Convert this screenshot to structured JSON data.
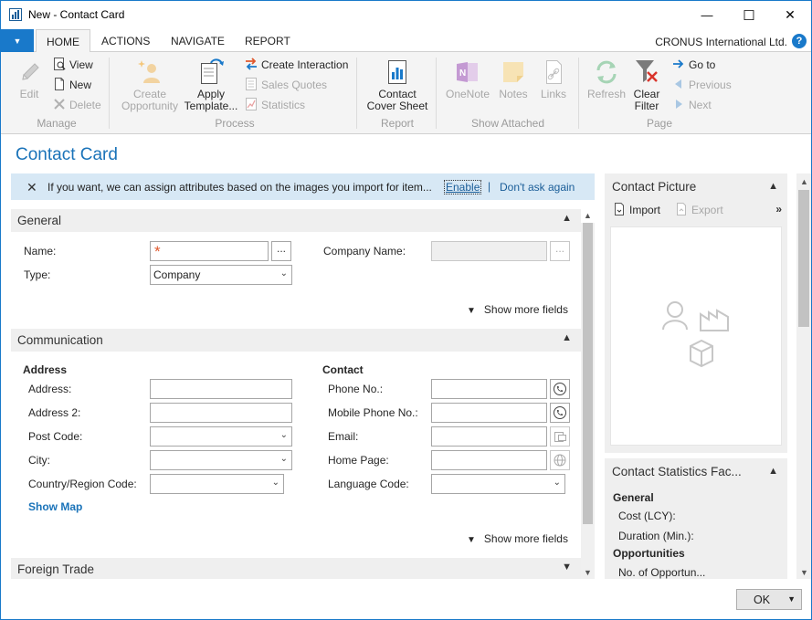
{
  "window": {
    "title": "New - Contact Card",
    "minimize_glyph": "—",
    "maximize_glyph": "☐",
    "close_glyph": "✕"
  },
  "ribbon_tabs": {
    "items": [
      {
        "label": "HOME",
        "active": true
      },
      {
        "label": "ACTIONS",
        "active": false
      },
      {
        "label": "NAVIGATE",
        "active": false
      },
      {
        "label": "REPORT",
        "active": false
      }
    ],
    "company": "CRONUS International Ltd.",
    "help_glyph": "?"
  },
  "ribbon": {
    "manage": {
      "label": "Manage",
      "edit": "Edit",
      "view": "View",
      "new": "New",
      "delete": "Delete"
    },
    "process": {
      "label": "Process",
      "create_opportunity": "Create Opportunity",
      "apply_template": "Apply Template...",
      "create_interaction": "Create Interaction",
      "sales_quotes": "Sales Quotes",
      "statistics": "Statistics"
    },
    "report": {
      "label": "Report",
      "contact_cover_sheet": "Contact Cover Sheet"
    },
    "show_attached": {
      "label": "Show Attached",
      "onenote": "OneNote",
      "notes": "Notes",
      "links": "Links"
    },
    "page": {
      "label": "Page",
      "refresh": "Refresh",
      "clear_filter": "Clear Filter",
      "go_to": "Go to",
      "previous": "Previous",
      "next": "Next"
    }
  },
  "page_title": "Contact Card",
  "notification": {
    "text": "If you want, we can assign attributes based on the images you import for item...",
    "enable": "Enable",
    "separator": "|",
    "dont_ask": "Don't ask again"
  },
  "general": {
    "title": "General",
    "name_label": "Name:",
    "name_required_mark": "*",
    "name_value": "",
    "type_label": "Type:",
    "type_value": "Company",
    "company_name_label": "Company Name:",
    "company_name_value": "",
    "show_more": "Show more fields"
  },
  "communication": {
    "title": "Communication",
    "address_heading": "Address",
    "address_label": "Address:",
    "address2_label": "Address 2:",
    "post_code_label": "Post Code:",
    "city_label": "City:",
    "country_label": "Country/Region Code:",
    "show_map": "Show Map",
    "contact_heading": "Contact",
    "phone_label": "Phone No.:",
    "mobile_label": "Mobile Phone No.:",
    "email_label": "Email:",
    "homepage_label": "Home Page:",
    "language_label": "Language Code:",
    "show_more": "Show more fields"
  },
  "foreign_trade": {
    "title": "Foreign Trade"
  },
  "factbox": {
    "picture": {
      "title": "Contact Picture",
      "import": "Import",
      "export": "Export"
    },
    "statistics": {
      "title": "Contact Statistics Fac...",
      "general_heading": "General",
      "cost": "Cost (LCY):",
      "duration": "Duration (Min.):",
      "opportunities_heading": "Opportunities",
      "no_of_opportunities": "No. of Opportun..."
    }
  },
  "footer": {
    "ok": "OK"
  },
  "colors": {
    "accent": "#1979ca",
    "link": "#1a73b9",
    "notification_bg": "#d7e8f5",
    "required_mark": "#e0582d"
  }
}
